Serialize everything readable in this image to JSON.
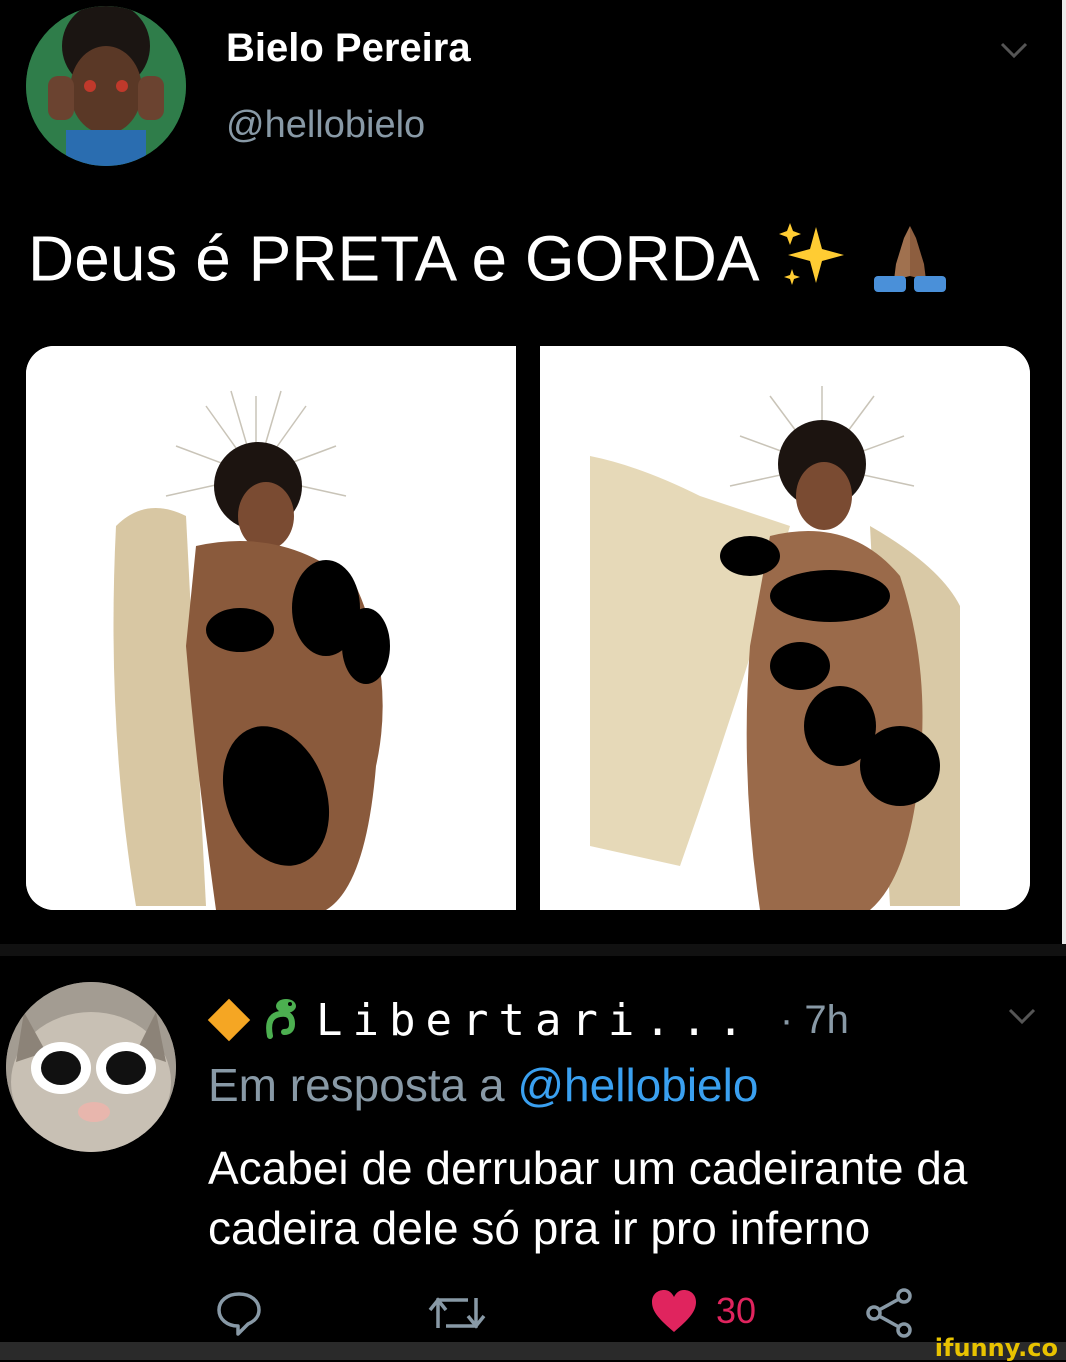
{
  "tweet": {
    "author_name": "Bielo Pereira",
    "author_handle": "@hellobielo",
    "text": "Deus é PRETA e GORDA",
    "emoji_names": [
      "sparkles-icon",
      "praying-hands-icon"
    ]
  },
  "reply": {
    "author_name": "Libertari...",
    "time": "· 7h",
    "reply_prefix": "Em resposta a",
    "reply_handle": "@hellobielo",
    "text": "Acabei de derrubar um cadeirante da cadeira dele só pra ir pro inferno",
    "like_count": "30"
  },
  "watermark": "ifunny.co",
  "colors": {
    "background": "#000000",
    "secondary_text": "#8899a6",
    "link": "#3aa0f0",
    "like": "#e0245e",
    "diamond": "#f5a623",
    "snake": "#4caf50"
  }
}
